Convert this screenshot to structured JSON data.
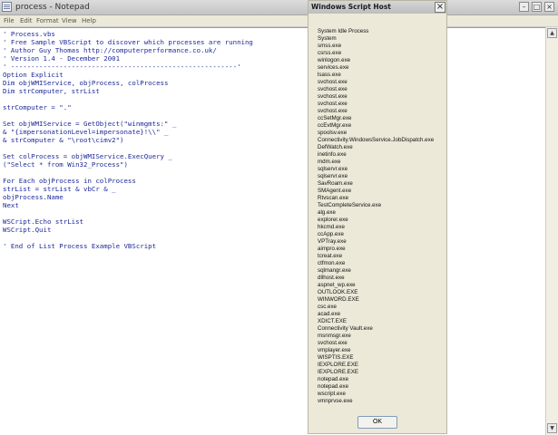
{
  "notepad": {
    "title": "process - Notepad",
    "menu": [
      "File",
      "Edit",
      "Format",
      "View",
      "Help"
    ],
    "lines": [
      "' Process.vbs",
      "' Free Sample VBScript to discover which processes are running",
      "' Author Guy Thomas http://computerperformance.co.uk/",
      "' Version 1.4 - December 2001",
      "' --------------------------------------------------------'",
      "Option Explicit",
      "Dim objWMIService, objProcess, colProcess",
      "Dim strComputer, strList",
      "",
      "strComputer = \".\"",
      "",
      "Set objWMIService = GetObject(\"winmgmts:\" _",
      "& \"{impersonationLevel=impersonate}!\\\\\" _",
      "& strComputer & \"\\root\\cimv2\")",
      "",
      "Set colProcess = objWMIService.ExecQuery _",
      "(\"Select * from Win32_Process\")",
      "",
      "For Each objProcess in colProcess",
      "strList = strList & vbCr & _",
      "objProcess.Name",
      "Next",
      "",
      "WSCript.Echo strList",
      "WSCript.Quit",
      "",
      "' End of List Process Example VBScript"
    ]
  },
  "dialog": {
    "title": "Windows Script Host",
    "close_label": "×",
    "processes": [
      "System Idle Process",
      "System",
      "smss.exe",
      "csrss.exe",
      "winlogon.exe",
      "services.exe",
      "lsass.exe",
      "svchost.exe",
      "svchost.exe",
      "svchost.exe",
      "svchost.exe",
      "svchost.exe",
      "ccSetMgr.exe",
      "ccEvtMgr.exe",
      "spoolsv.exe",
      "Connectivity.WindowsService.JobDispatch.exe",
      "DefWatch.exe",
      "inetinfo.exe",
      "mdm.exe",
      "sqlservr.exe",
      "sqlservr.exe",
      "SavRoam.exe",
      "SMAgent.exe",
      "Rtvscan.exe",
      "TestCompleteService.exe",
      "alg.exe",
      "explorer.exe",
      "hkcmd.exe",
      "ccApp.exe",
      "VPTray.exe",
      "aimpro.exe",
      "tcreat.exe",
      "ctfmon.exe",
      "sqlmangr.exe",
      "dllhost.exe",
      "aspnet_wp.exe",
      "OUTLOOK.EXE",
      "WINWORD.EXE",
      "csc.exe",
      "acad.exe",
      "XDICT.EXE",
      "Connectivity Vault.exe",
      "msnmsgr.exe",
      "svchost.exe",
      "vmplayer.exe",
      "WISPTIS.EXE",
      "IEXPLORE.EXE",
      "IEXPLORE.EXE",
      "notepad.exe",
      "notepad.exe",
      "wscript.exe",
      "vmnprvse.exe"
    ],
    "ok_label": "OK"
  },
  "icons": {
    "notepad": "notepad-icon",
    "minimize": "minimize-icon",
    "maximize": "maximize-icon",
    "close": "close-icon"
  },
  "colors": {
    "code_text": "#1e2a9a",
    "dialog_bg": "#ece9d8"
  }
}
